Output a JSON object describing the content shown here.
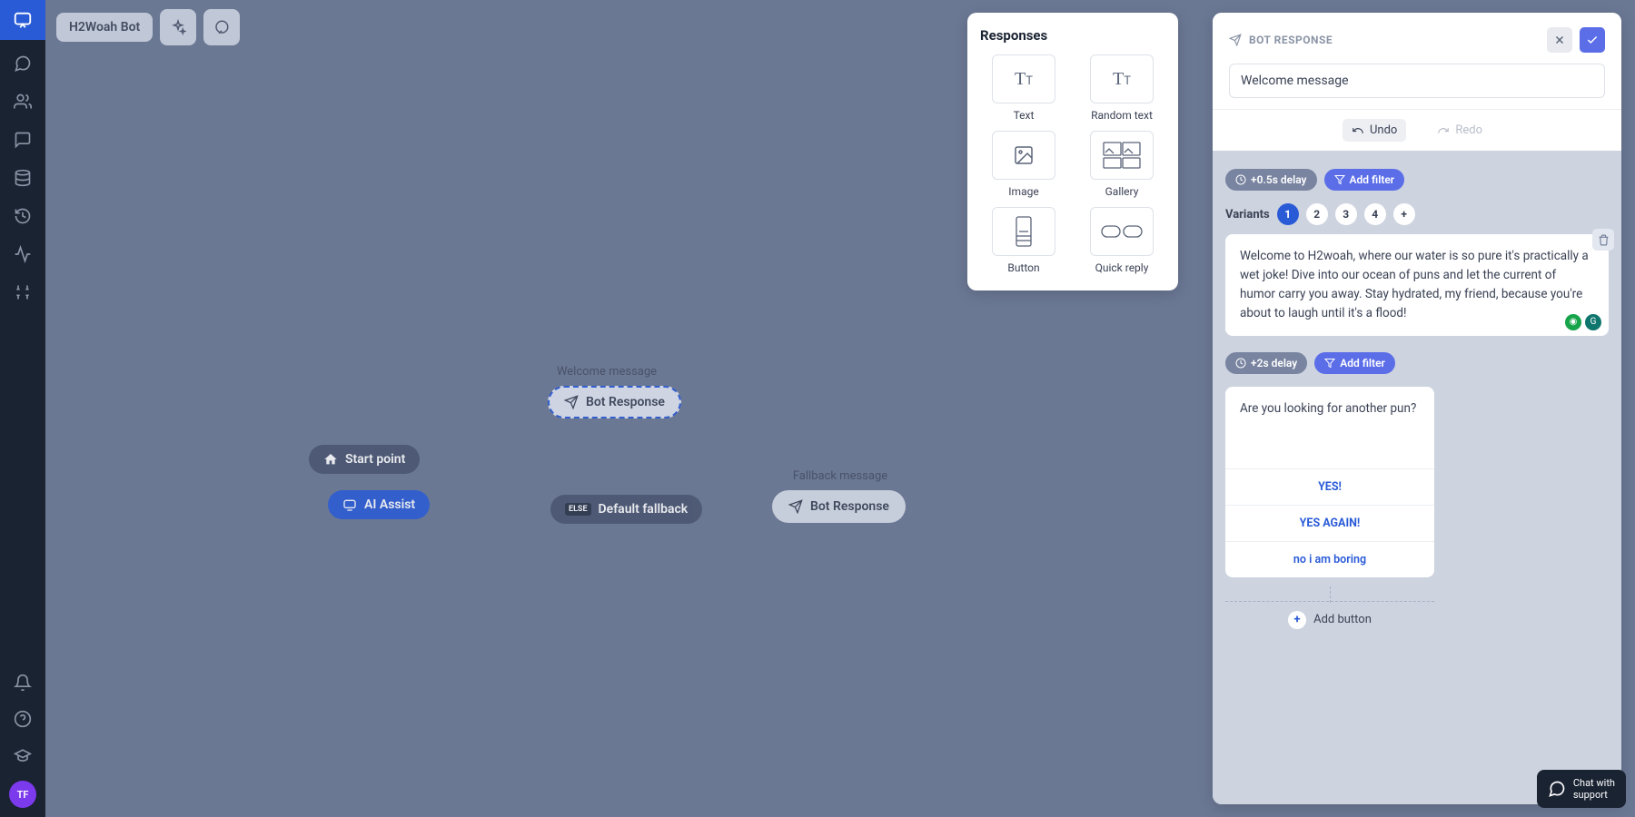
{
  "app": {
    "bot_name": "H2Woah Bot",
    "avatar_initials": "TF"
  },
  "canvas": {
    "start_label": "Start point",
    "ai_assist_label": "AI Assist",
    "welcome_label": "Welcome message",
    "bot_response_label": "Bot Response",
    "default_fallback_label": "Default fallback",
    "else_tag": "ELSE",
    "fallback_msg_label": "Fallback message"
  },
  "responses_panel": {
    "title": "Responses",
    "items": [
      {
        "label": "Text",
        "icon": "text"
      },
      {
        "label": "Random text",
        "icon": "text"
      },
      {
        "label": "Image",
        "icon": "image"
      },
      {
        "label": "Gallery",
        "icon": "gallery"
      },
      {
        "label": "Button",
        "icon": "button"
      },
      {
        "label": "Quick reply",
        "icon": "quickreply"
      }
    ]
  },
  "side_panel": {
    "title": "BOT RESPONSE",
    "name_value": "Welcome message",
    "undo_label": "Undo",
    "redo_label": "Redo",
    "block1": {
      "delay_label": "+0.5s delay",
      "filter_label": "Add filter",
      "variants_label": "Variants",
      "variants": [
        "1",
        "2",
        "3",
        "4"
      ],
      "message_text": "Welcome to H2woah, where our water is so pure it's practically a wet joke! Dive into our ocean of puns and let the current of humor carry you away. Stay hydrated, my friend, because you're about to laugh until it's a flood!"
    },
    "block2": {
      "delay_label": "+2s delay",
      "filter_label": "Add filter",
      "prompt_text": "Are you looking for another pun?",
      "buttons": [
        "YES!",
        "YES AGAIN!",
        "no i am boring"
      ],
      "add_button_label": "Add button"
    }
  },
  "chat_widget": {
    "line1": "Chat with",
    "line2": "support"
  }
}
